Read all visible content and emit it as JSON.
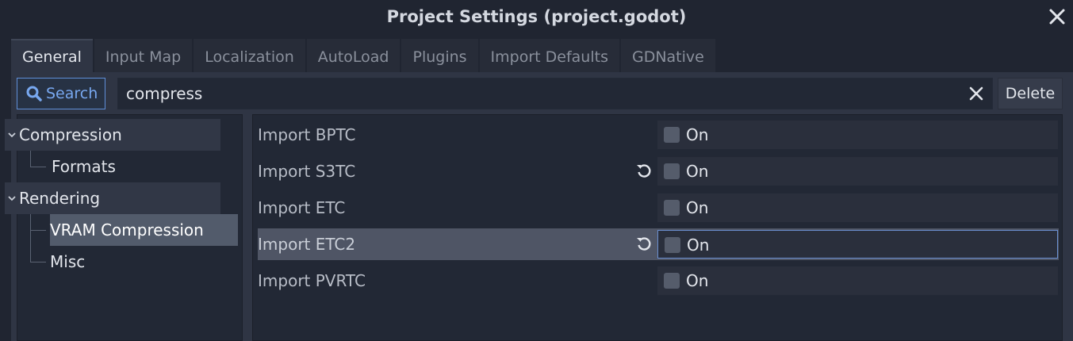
{
  "window": {
    "title": "Project Settings (project.godot)"
  },
  "tabs": [
    {
      "label": "General",
      "active": true
    },
    {
      "label": "Input Map",
      "active": false
    },
    {
      "label": "Localization",
      "active": false
    },
    {
      "label": "AutoLoad",
      "active": false
    },
    {
      "label": "Plugins",
      "active": false
    },
    {
      "label": "Import Defaults",
      "active": false
    },
    {
      "label": "GDNative",
      "active": false
    }
  ],
  "search": {
    "button_label": "Search",
    "value": "compress",
    "delete_label": "Delete"
  },
  "tree": {
    "categories": [
      {
        "label": "Compression",
        "children": [
          {
            "label": "Formats",
            "selected": false
          }
        ]
      },
      {
        "label": "Rendering",
        "children": [
          {
            "label": "VRAM Compression",
            "selected": true
          },
          {
            "label": "Misc",
            "selected": false
          }
        ]
      }
    ]
  },
  "properties": [
    {
      "label": "Import BPTC",
      "value_label": "On",
      "checked": false,
      "revertable": false
    },
    {
      "label": "Import S3TC",
      "value_label": "On",
      "checked": false,
      "revertable": true
    },
    {
      "label": "Import ETC",
      "value_label": "On",
      "checked": false,
      "revertable": false
    },
    {
      "label": "Import ETC2",
      "value_label": "On",
      "checked": false,
      "revertable": true,
      "highlighted": true
    },
    {
      "label": "Import PVRTC",
      "value_label": "On",
      "checked": false,
      "revertable": false
    }
  ],
  "colors": {
    "accent": "#5f8fd8",
    "background": "#202531",
    "panel": "#2f3544"
  }
}
